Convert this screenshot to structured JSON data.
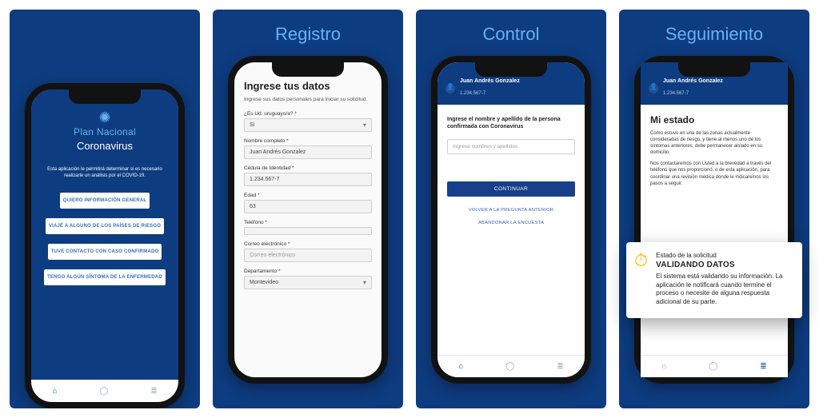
{
  "panels": {
    "p1": {
      "title": ""
    },
    "p2": {
      "title": "Registro"
    },
    "p3": {
      "title": "Control"
    },
    "p4": {
      "title": "Seguimiento"
    }
  },
  "splash": {
    "logo_line1": "Plan Nacional",
    "logo_line2": "Coronavirus",
    "intro": "Esta aplicación le permitirá determinar si es necesario realizarle un análisis por el COVID-19.",
    "buttons": [
      "QUIERO INFORMACIÓN GENERAL",
      "VIAJÉ A ALGUNO DE LOS PAÍSES DE RIESGO",
      "TUVE CONTACTO CON CASO CONFIRMADO",
      "TENGO ALGÚN SÍNTOMA DE LA ENFERMEDAD"
    ]
  },
  "form": {
    "heading": "Ingrese tus datos",
    "subheading": "Ingrese sus datos personales para iniciar su solicitud.",
    "fields": {
      "uruguayo": {
        "label": "¿Es Ud. uruguayo/a? *",
        "value": "Si"
      },
      "nombre": {
        "label": "Nombre completo *",
        "value": "Juan Andrés Gonzalez"
      },
      "cedula": {
        "label": "Cédula de Identidad *",
        "value": "1.234.567-7"
      },
      "edad": {
        "label": "Edad *",
        "value": "63"
      },
      "telefono": {
        "label": "Teléfono *",
        "value": ""
      },
      "correo": {
        "label": "Correo electrónico *",
        "value": "",
        "placeholder": "Correo electrónico"
      },
      "depto": {
        "label": "Departamento *",
        "value": "Montevideo"
      }
    }
  },
  "control": {
    "user_name": "Juan Andrés Gonzalez",
    "user_id": "1.234.567-7",
    "prompt": "Ingrese el nombre y apellido de la persona confirmada con Coronavirus",
    "placeholder": "Ingrese nombres y apellidos",
    "continue": "CONTINUAR",
    "back": "VOLVER A LA PREGUNTA ANTERIOR",
    "abandon": "ABANDONAR LA ENCUESTA"
  },
  "status": {
    "user_name": "Juan Andrés Gonzalez",
    "user_id": "1.234.567-7",
    "heading": "Mi estado",
    "para1": "Como estuvo en una de las zonas actualmente consideradas de riesgo, y tiene al menos uno de los síntomas anteriores, debe permanecer aislado en su domicilio.",
    "para2": "Nos contactaremos con Usted a la brevedad a través del teléfono que nos proporcionó, o de esta aplicación, para coordinar una revisión médica donde le indicaremos los pasos a seguir.",
    "card_k1": "Estado de la solicitud",
    "card_k2": "VALIDANDO DATOS",
    "card_k3": "El sistema está validando su información. La aplicación le notificará cuando termine el proceso o necesite de alguna respuesta adicional de su parte."
  }
}
